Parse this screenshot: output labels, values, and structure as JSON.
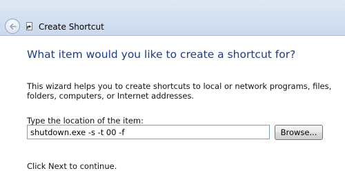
{
  "window": {
    "title": "Create Shortcut",
    "back_icon": "back-arrow-icon",
    "wizard_icon": "shortcut-wizard-icon"
  },
  "content": {
    "heading": "What item would you like to create a shortcut for?",
    "description": "This wizard helps you to create shortcuts to local or network programs, files, folders, computers, or Internet addresses.",
    "location_label": "Type the location of the item:",
    "location_value": "shutdown.exe -s -t 00 -f",
    "browse_label": "Browse...",
    "continue_text": "Click Next to continue."
  },
  "colors": {
    "heading": "#1e3a8c",
    "titlebar": "#d4e1f1",
    "input_border": "#7a9cc8"
  }
}
